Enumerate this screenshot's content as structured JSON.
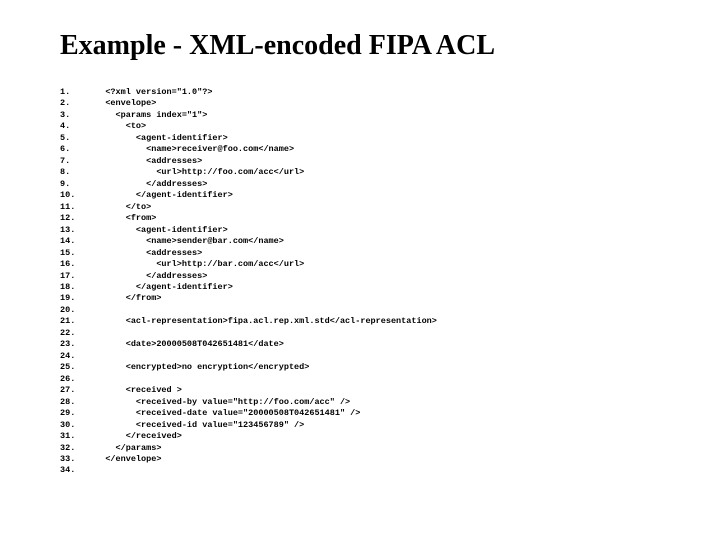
{
  "title": "Example - XML-encoded FIPA ACL",
  "lineNumbers": "1.\n2.\n3.\n4.\n5.\n6.\n7.\n8.\n9.\n10.\n11.\n12.\n13.\n14.\n15.\n16.\n17.\n18.\n19.\n20.\n21.\n22.\n23.\n24.\n25.\n26.\n27.\n28.\n29.\n30.\n31.\n32.\n33.\n34.",
  "codeLines": "<?xml version=\"1.0\"?>\n<envelope>\n  <params index=\"1\">\n    <to>\n      <agent-identifier>\n        <name>receiver@foo.com</name>\n        <addresses>\n          <url>http://foo.com/acc</url>\n        </addresses>\n      </agent-identifier>\n    </to>\n    <from>\n      <agent-identifier>\n        <name>sender@bar.com</name>\n        <addresses>\n          <url>http://bar.com/acc</url>\n        </addresses>\n      </agent-identifier>\n    </from>\n\n    <acl-representation>fipa.acl.rep.xml.std</acl-representation>\n\n    <date>20000508T042651481</date>\n\n    <encrypted>no encryption</encrypted>\n\n    <received >\n      <received-by value=\"http://foo.com/acc\" />\n      <received-date value=\"20000508T042651481\" />\n      <received-id value=\"123456789\" />\n    </received>\n  </params>\n</envelope>\n"
}
